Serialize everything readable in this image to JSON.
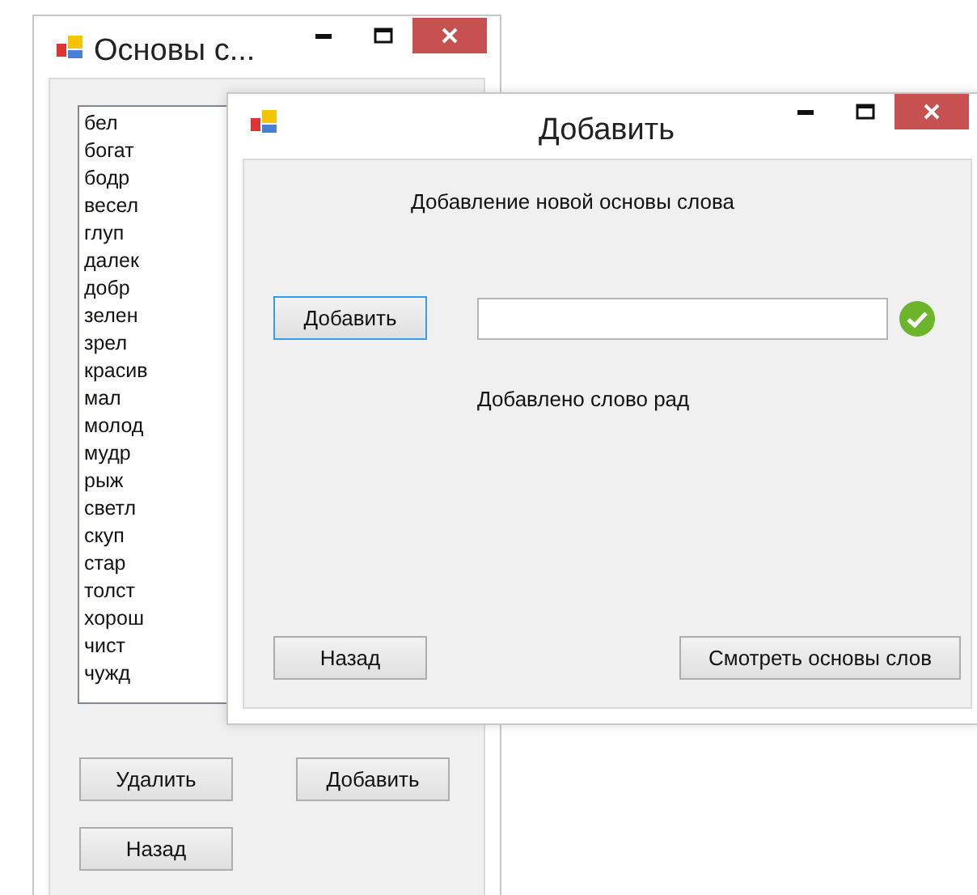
{
  "main_window": {
    "title": "Основы с...",
    "list_items": [
      "бел",
      "богат",
      "бодр",
      "весел",
      "глуп",
      "далек",
      "добр",
      "зелен",
      "зрел",
      "красив",
      "мал",
      "молод",
      "мудр",
      "рыж",
      "светл",
      "скуп",
      "стар",
      "толст",
      "хорош",
      "чист",
      "чужд"
    ],
    "buttons": [
      {
        "label": "Удалить"
      },
      {
        "label": "Добавить"
      },
      {
        "label": "Назад"
      }
    ]
  },
  "add_dialog": {
    "title": "Добавить",
    "heading": "Добавление новой основы слова",
    "add_button": {
      "label": "Добавить",
      "focused": true
    },
    "status": "Добавлено слово рад",
    "back_button": {
      "label": "Назад",
      "focused": false
    },
    "view_button": {
      "label": "Смотреть основы слов",
      "focused": false
    }
  }
}
